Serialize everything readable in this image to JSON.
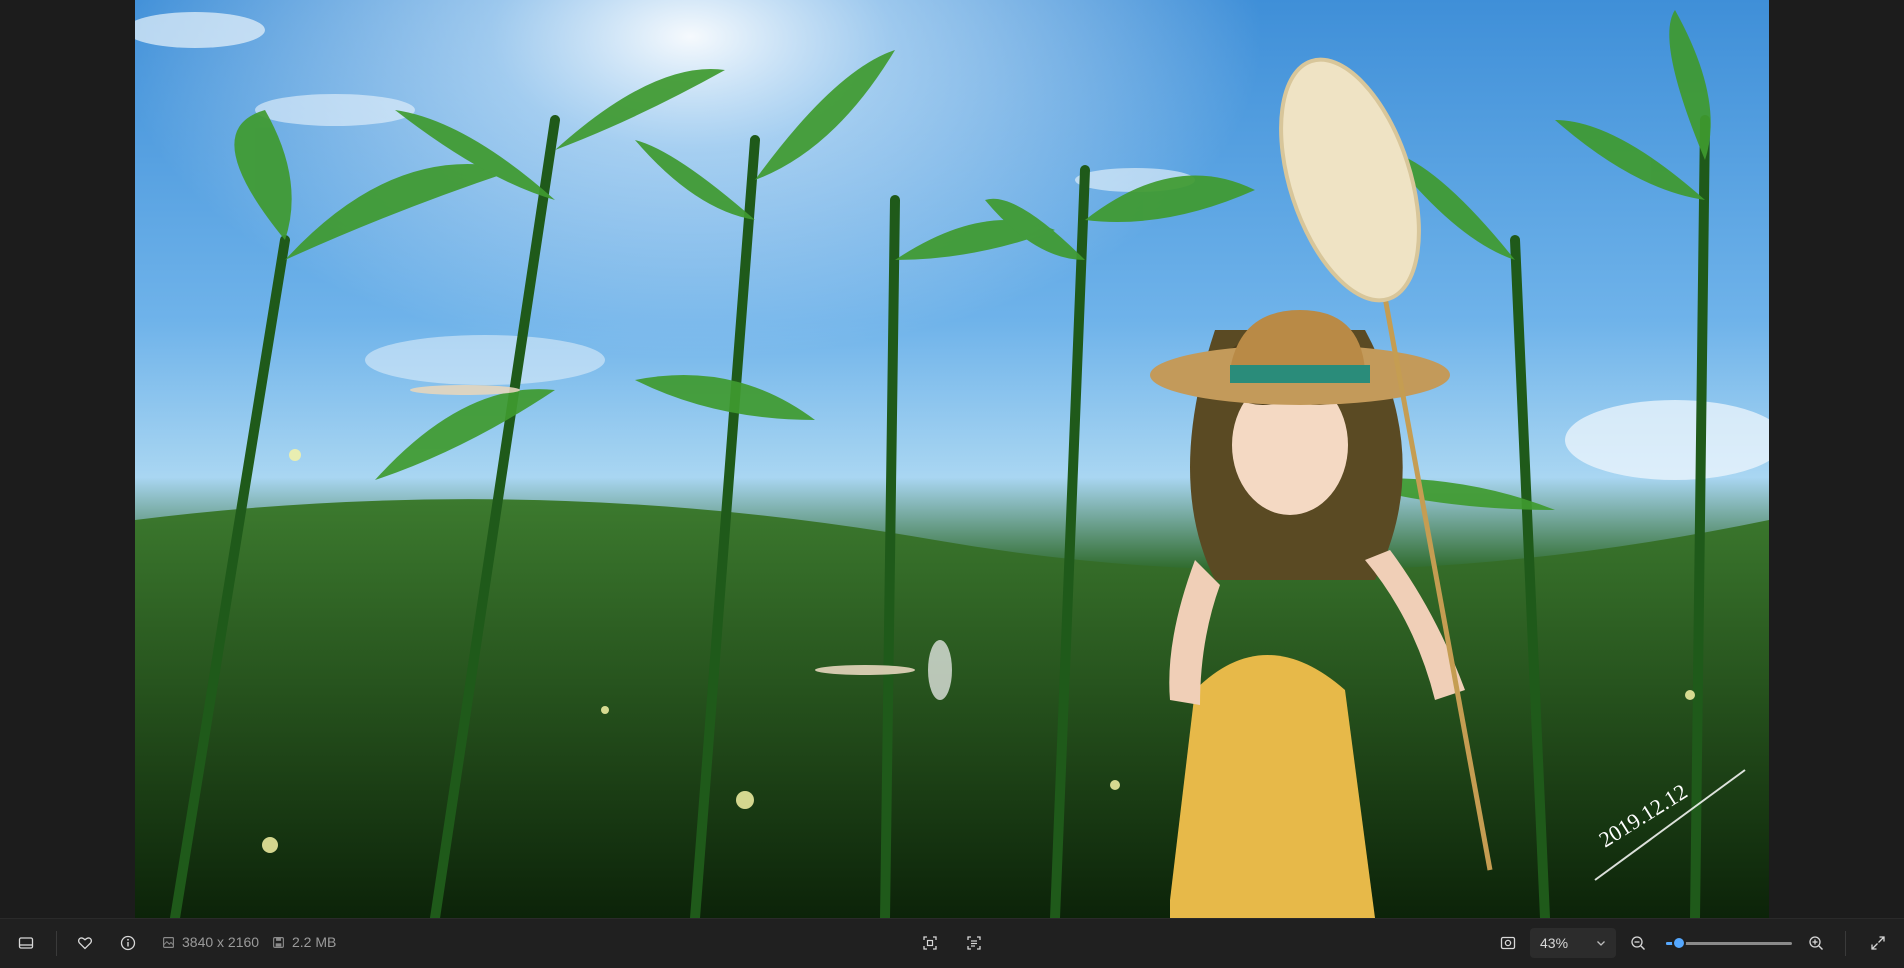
{
  "image": {
    "signature_text": "2019.12.12"
  },
  "toolbar": {
    "filmstrip_icon": "filmstrip-icon",
    "favorite_icon": "heart-icon",
    "info_icon": "info-icon",
    "dimensions": "3840 x 2160",
    "file_size": "2.2 MB",
    "zoom_value": "43%",
    "zoom_level": 0.1,
    "colors": {
      "accent": "#55a8ff",
      "background": "#202020"
    }
  }
}
